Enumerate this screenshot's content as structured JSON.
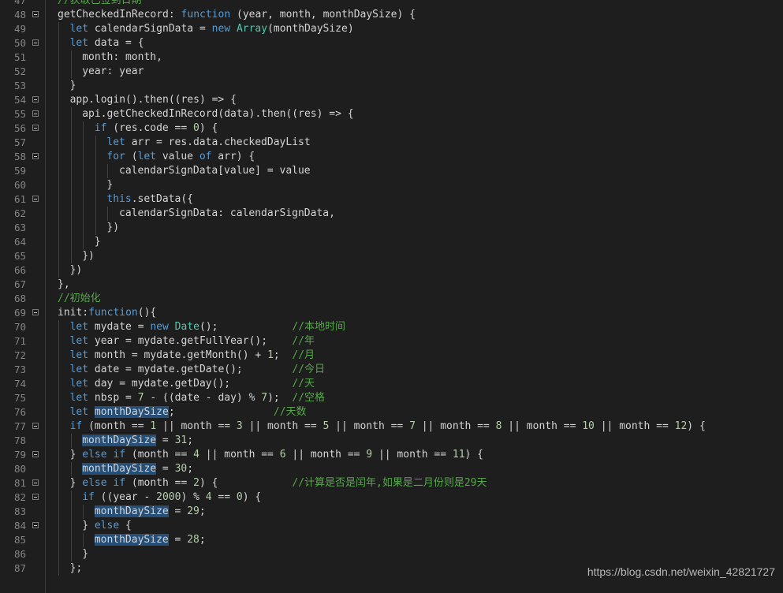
{
  "editor": {
    "lines": [
      {
        "n": "47",
        "fold": false,
        "indent": 0,
        "tokens": [
          [
            "cmt",
            "//获取已签到日期"
          ]
        ]
      },
      {
        "n": "48",
        "fold": true,
        "indent": 0,
        "tokens": [
          [
            "p",
            "getCheckedInRecord: "
          ],
          [
            "kw",
            "function"
          ],
          [
            "p",
            " (year, month, monthDaySize) {"
          ]
        ]
      },
      {
        "n": "49",
        "fold": false,
        "indent": 1,
        "tokens": [
          [
            "kw",
            "let"
          ],
          [
            "p",
            " calendarSignData = "
          ],
          [
            "kw",
            "new"
          ],
          [
            "p",
            " "
          ],
          [
            "cls",
            "Array"
          ],
          [
            "p",
            "(monthDaySize)"
          ]
        ]
      },
      {
        "n": "50",
        "fold": true,
        "indent": 1,
        "tokens": [
          [
            "kw",
            "let"
          ],
          [
            "p",
            " data = {"
          ]
        ]
      },
      {
        "n": "51",
        "fold": false,
        "indent": 2,
        "tokens": [
          [
            "p",
            "month: month,"
          ]
        ]
      },
      {
        "n": "52",
        "fold": false,
        "indent": 2,
        "tokens": [
          [
            "p",
            "year: year"
          ]
        ]
      },
      {
        "n": "53",
        "fold": false,
        "indent": 1,
        "tokens": [
          [
            "p",
            "}"
          ]
        ]
      },
      {
        "n": "54",
        "fold": true,
        "indent": 1,
        "tokens": [
          [
            "p",
            "app.login().then((res) => {"
          ]
        ]
      },
      {
        "n": "55",
        "fold": true,
        "indent": 2,
        "tokens": [
          [
            "p",
            "api.getCheckedInRecord(data).then((res) => {"
          ]
        ]
      },
      {
        "n": "56",
        "fold": true,
        "indent": 3,
        "tokens": [
          [
            "kw",
            "if"
          ],
          [
            "p",
            " (res.code == "
          ],
          [
            "num",
            "0"
          ],
          [
            "p",
            ") {"
          ]
        ]
      },
      {
        "n": "57",
        "fold": false,
        "indent": 4,
        "tokens": [
          [
            "kw",
            "let"
          ],
          [
            "p",
            " arr = res.data.checkedDayList"
          ]
        ]
      },
      {
        "n": "58",
        "fold": true,
        "indent": 4,
        "tokens": [
          [
            "kw",
            "for"
          ],
          [
            "p",
            " ("
          ],
          [
            "kw",
            "let"
          ],
          [
            "p",
            " value "
          ],
          [
            "kw",
            "of"
          ],
          [
            "p",
            " arr) {"
          ]
        ]
      },
      {
        "n": "59",
        "fold": false,
        "indent": 5,
        "tokens": [
          [
            "p",
            "calendarSignData[value] = value"
          ]
        ]
      },
      {
        "n": "60",
        "fold": false,
        "indent": 4,
        "tokens": [
          [
            "p",
            "}"
          ]
        ]
      },
      {
        "n": "61",
        "fold": true,
        "indent": 4,
        "tokens": [
          [
            "kw",
            "this"
          ],
          [
            "p",
            ".setData({"
          ]
        ]
      },
      {
        "n": "62",
        "fold": false,
        "indent": 5,
        "tokens": [
          [
            "p",
            "calendarSignData: calendarSignData,"
          ]
        ]
      },
      {
        "n": "63",
        "fold": false,
        "indent": 4,
        "tokens": [
          [
            "p",
            "})"
          ]
        ]
      },
      {
        "n": "64",
        "fold": false,
        "indent": 3,
        "tokens": [
          [
            "p",
            "}"
          ]
        ]
      },
      {
        "n": "65",
        "fold": false,
        "indent": 2,
        "tokens": [
          [
            "p",
            "})"
          ]
        ]
      },
      {
        "n": "66",
        "fold": false,
        "indent": 1,
        "tokens": [
          [
            "p",
            "})"
          ]
        ]
      },
      {
        "n": "67",
        "fold": false,
        "indent": 0,
        "tokens": [
          [
            "p",
            "},"
          ]
        ]
      },
      {
        "n": "68",
        "fold": false,
        "indent": 0,
        "tokens": [
          [
            "cmt",
            "//初始化"
          ]
        ]
      },
      {
        "n": "69",
        "fold": true,
        "indent": 0,
        "tokens": [
          [
            "p",
            "init:"
          ],
          [
            "kw",
            "function"
          ],
          [
            "p",
            "(){"
          ]
        ]
      },
      {
        "n": "70",
        "fold": false,
        "indent": 1,
        "tokens": [
          [
            "kw",
            "let"
          ],
          [
            "p",
            " mydate = "
          ],
          [
            "kw",
            "new"
          ],
          [
            "p",
            " "
          ],
          [
            "cls",
            "Date"
          ],
          [
            "p",
            "();            "
          ],
          [
            "cmt",
            "//本地时间"
          ]
        ]
      },
      {
        "n": "71",
        "fold": false,
        "indent": 1,
        "tokens": [
          [
            "kw",
            "let"
          ],
          [
            "p",
            " year = mydate.getFullYear();    "
          ],
          [
            "cmt",
            "//年"
          ]
        ]
      },
      {
        "n": "72",
        "fold": false,
        "indent": 1,
        "tokens": [
          [
            "kw",
            "let"
          ],
          [
            "p",
            " month = mydate.getMonth() + "
          ],
          [
            "num",
            "1"
          ],
          [
            "p",
            ";  "
          ],
          [
            "cmt",
            "//月"
          ]
        ]
      },
      {
        "n": "73",
        "fold": false,
        "indent": 1,
        "tokens": [
          [
            "kw",
            "let"
          ],
          [
            "p",
            " date = mydate.getDate();        "
          ],
          [
            "cmt",
            "//今日"
          ]
        ]
      },
      {
        "n": "74",
        "fold": false,
        "indent": 1,
        "tokens": [
          [
            "kw",
            "let"
          ],
          [
            "p",
            " day = mydate.getDay();          "
          ],
          [
            "cmt",
            "//天"
          ]
        ]
      },
      {
        "n": "75",
        "fold": false,
        "indent": 1,
        "tokens": [
          [
            "kw",
            "let"
          ],
          [
            "p",
            " nbsp = "
          ],
          [
            "num",
            "7"
          ],
          [
            "p",
            " - ((date - day) % "
          ],
          [
            "num",
            "7"
          ],
          [
            "p",
            ");  "
          ],
          [
            "cmt",
            "//空格"
          ]
        ]
      },
      {
        "n": "76",
        "fold": false,
        "indent": 1,
        "tokens": [
          [
            "kw",
            "let"
          ],
          [
            "p",
            " "
          ],
          [
            "hl",
            "monthDaySize"
          ],
          [
            "p",
            ";                "
          ],
          [
            "cmt",
            "//天数"
          ]
        ]
      },
      {
        "n": "77",
        "fold": true,
        "indent": 1,
        "tokens": [
          [
            "kw",
            "if"
          ],
          [
            "p",
            " (month == "
          ],
          [
            "num",
            "1"
          ],
          [
            "p",
            " || month == "
          ],
          [
            "num",
            "3"
          ],
          [
            "p",
            " || month == "
          ],
          [
            "num",
            "5"
          ],
          [
            "p",
            " || month == "
          ],
          [
            "num",
            "7"
          ],
          [
            "p",
            " || month == "
          ],
          [
            "num",
            "8"
          ],
          [
            "p",
            " || month == "
          ],
          [
            "num",
            "10"
          ],
          [
            "p",
            " || month == "
          ],
          [
            "num",
            "12"
          ],
          [
            "p",
            ") {"
          ]
        ]
      },
      {
        "n": "78",
        "fold": false,
        "indent": 2,
        "tokens": [
          [
            "hl",
            "monthDaySize"
          ],
          [
            "p",
            " = "
          ],
          [
            "num",
            "31"
          ],
          [
            "p",
            ";"
          ]
        ]
      },
      {
        "n": "79",
        "fold": true,
        "indent": 1,
        "tokens": [
          [
            "p",
            "} "
          ],
          [
            "kw",
            "else"
          ],
          [
            "p",
            " "
          ],
          [
            "kw",
            "if"
          ],
          [
            "p",
            " (month == "
          ],
          [
            "num",
            "4"
          ],
          [
            "p",
            " || month == "
          ],
          [
            "num",
            "6"
          ],
          [
            "p",
            " || month == "
          ],
          [
            "num",
            "9"
          ],
          [
            "p",
            " || month == "
          ],
          [
            "num",
            "11"
          ],
          [
            "p",
            ") {"
          ]
        ]
      },
      {
        "n": "80",
        "fold": false,
        "indent": 2,
        "tokens": [
          [
            "hl",
            "monthDaySize"
          ],
          [
            "p",
            " = "
          ],
          [
            "num",
            "30"
          ],
          [
            "p",
            ";"
          ]
        ]
      },
      {
        "n": "81",
        "fold": true,
        "indent": 1,
        "tokens": [
          [
            "p",
            "} "
          ],
          [
            "kw",
            "else"
          ],
          [
            "p",
            " "
          ],
          [
            "kw",
            "if"
          ],
          [
            "p",
            " (month == "
          ],
          [
            "num",
            "2"
          ],
          [
            "p",
            ") {            "
          ],
          [
            "cmt",
            "//计算是否是闰年,如果是二月份则是29天"
          ]
        ]
      },
      {
        "n": "82",
        "fold": true,
        "indent": 2,
        "tokens": [
          [
            "kw",
            "if"
          ],
          [
            "p",
            " ((year - "
          ],
          [
            "num",
            "2000"
          ],
          [
            "p",
            ") % "
          ],
          [
            "num",
            "4"
          ],
          [
            "p",
            " == "
          ],
          [
            "num",
            "0"
          ],
          [
            "p",
            ") {"
          ]
        ]
      },
      {
        "n": "83",
        "fold": false,
        "indent": 3,
        "tokens": [
          [
            "hl",
            "monthDaySize"
          ],
          [
            "p",
            " = "
          ],
          [
            "num",
            "29"
          ],
          [
            "p",
            ";"
          ]
        ]
      },
      {
        "n": "84",
        "fold": true,
        "indent": 2,
        "tokens": [
          [
            "p",
            "} "
          ],
          [
            "kw",
            "else"
          ],
          [
            "p",
            " {"
          ]
        ]
      },
      {
        "n": "85",
        "fold": false,
        "indent": 3,
        "tokens": [
          [
            "hl",
            "monthDaySize"
          ],
          [
            "p",
            " = "
          ],
          [
            "num",
            "28"
          ],
          [
            "p",
            ";"
          ]
        ]
      },
      {
        "n": "86",
        "fold": false,
        "indent": 2,
        "tokens": [
          [
            "p",
            "}"
          ]
        ]
      },
      {
        "n": "87",
        "fold": false,
        "indent": 1,
        "tokens": [
          [
            "p",
            "};"
          ]
        ]
      }
    ]
  },
  "watermark": "https://blog.csdn.net/weixin_42821727",
  "colors": {
    "background": "#1e1e1e",
    "keyword": "#569cd6",
    "comment": "#57a64a",
    "number": "#b5cea8",
    "class": "#4ec9b0",
    "highlight": "#264f78"
  }
}
